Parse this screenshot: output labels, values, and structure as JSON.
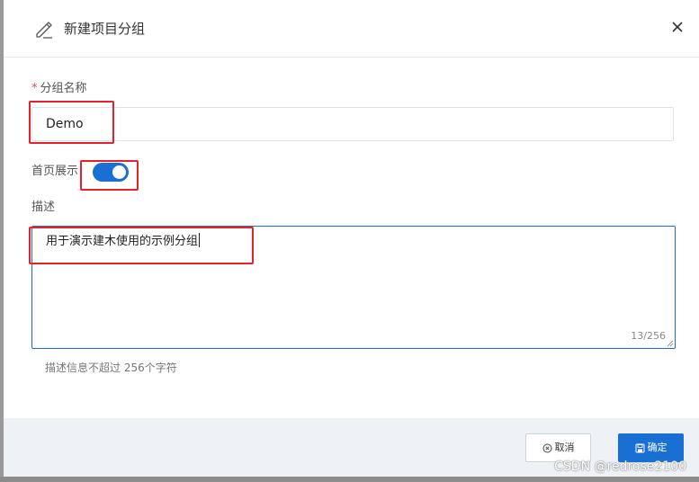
{
  "dialog": {
    "title": "新建项目分组",
    "icons": {
      "title": "edit-pencil-icon",
      "close": "close-x-icon",
      "cancel": "circle-x-icon",
      "confirm": "save-disk-icon"
    }
  },
  "form": {
    "name": {
      "required_mark": "*",
      "label": "分组名称",
      "value": "Demo"
    },
    "homepage_display": {
      "label": "首页展示",
      "checked": true
    },
    "description": {
      "label": "描述",
      "value": "用于演示建木使用的示例分组",
      "counter": "13/256",
      "hint": "描述信息不超过 256个字符"
    }
  },
  "footer": {
    "cancel_label": "取消",
    "confirm_label": "确定"
  },
  "watermark": "CSDN @redrose2100",
  "colors": {
    "primary": "#1a6fd4",
    "highlight": "#e8202a",
    "footer_bg": "#eef2f7"
  }
}
